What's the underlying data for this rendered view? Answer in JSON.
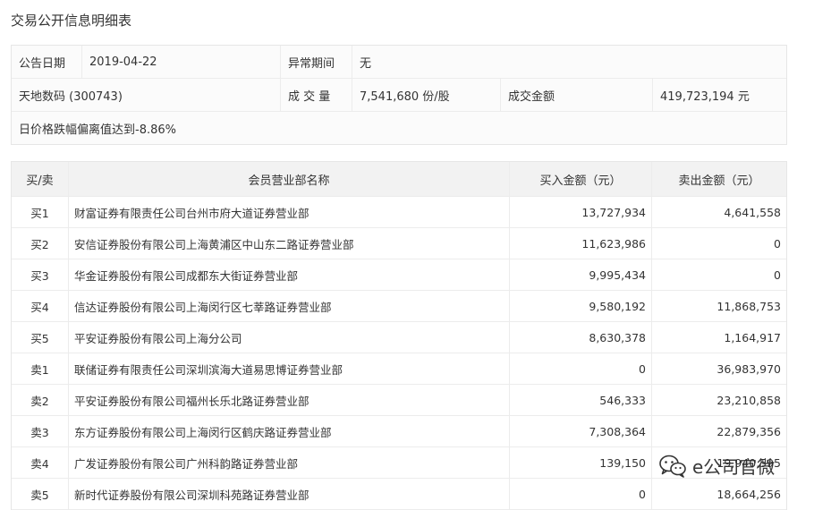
{
  "title": "交易公开信息明细表",
  "info": {
    "date_label": "公告日期",
    "date_value": "2019-04-22",
    "abnormal_label": "异常期间",
    "abnormal_value": "无",
    "stock_name": "天地数码 (300743)",
    "volume_label": "成 交 量",
    "volume_value": "7,541,680 份/股",
    "amount_label": "成交金额",
    "amount_value": "419,723,194 元",
    "reason": "日价格跌幅偏离值达到-8.86%"
  },
  "table": {
    "headers": [
      "买/卖",
      "会员营业部名称",
      "买入金额（元）",
      "卖出金额（元）"
    ],
    "rows": [
      [
        "买1",
        "财富证券有限责任公司台州市府大道证券营业部",
        "13,727,934",
        "4,641,558"
      ],
      [
        "买2",
        "安信证券股份有限公司上海黄浦区中山东二路证券营业部",
        "11,623,986",
        "0"
      ],
      [
        "买3",
        "华金证券股份有限公司成都东大街证券营业部",
        "9,995,434",
        "0"
      ],
      [
        "买4",
        "信达证券股份有限公司上海闵行区七莘路证券营业部",
        "9,580,192",
        "11,868,753"
      ],
      [
        "买5",
        "平安证券股份有限公司上海分公司",
        "8,630,378",
        "1,164,917"
      ],
      [
        "卖1",
        "联储证券有限责任公司深圳滨海大道易思博证券营业部",
        "0",
        "36,983,970"
      ],
      [
        "卖2",
        "平安证券股份有限公司福州长乐北路证券营业部",
        "546,333",
        "23,210,858"
      ],
      [
        "卖3",
        "东方证券股份有限公司上海闵行区鹤庆路证券营业部",
        "7,308,364",
        "22,879,356"
      ],
      [
        "卖4",
        "广发证券股份有限公司广州科韵路证券营业部",
        "139,150",
        "19,940,595"
      ],
      [
        "卖5",
        "新时代证券股份有限公司深圳科苑路证券营业部",
        "0",
        "18,664,256"
      ]
    ]
  },
  "watermark": {
    "text": "e公司官微",
    "icon": "wechat-icon"
  }
}
